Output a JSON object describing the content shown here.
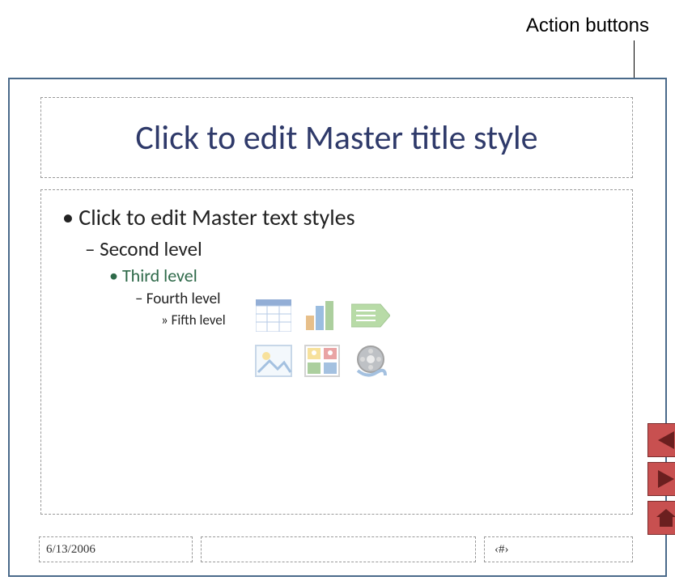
{
  "annotation": {
    "label": "Action buttons"
  },
  "title": {
    "text": "Click to edit Master title style"
  },
  "content": {
    "lvl1": "Click to edit Master text styles",
    "lvl2": "Second level",
    "lvl3": "Third level",
    "lvl4": "Fourth level",
    "lvl5": "Fifth level"
  },
  "icons": {
    "table": "table-icon",
    "chart": "chart-icon",
    "smartart": "smartart-icon",
    "picture": "picture-icon",
    "clipart": "clipart-icon",
    "media": "media-icon"
  },
  "footer": {
    "date": "6/13/2006",
    "center": "",
    "slidenum": "‹#›"
  },
  "actions": {
    "back": "action-back-button",
    "forward": "action-forward-button",
    "home": "action-home-button"
  },
  "colors": {
    "frame": "#4a6a8a",
    "title": "#2f3a6a",
    "lvl3": "#2f6a4a",
    "action": "#c85050"
  }
}
